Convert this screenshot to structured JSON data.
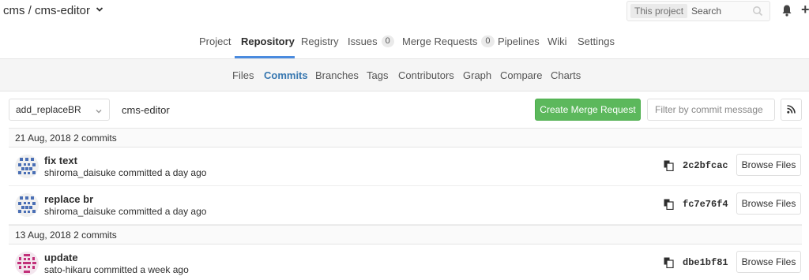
{
  "header": {
    "project_path": "cms / cms-editor",
    "search": {
      "scope": "This project",
      "placeholder": "Search"
    }
  },
  "project_nav": {
    "items": [
      {
        "label": "Project"
      },
      {
        "label": "Repository",
        "active": true
      },
      {
        "label": "Registry"
      },
      {
        "label": "Issues",
        "count": "0"
      },
      {
        "label": "Merge Requests",
        "count": "0"
      },
      {
        "label": "Pipelines"
      },
      {
        "label": "Wiki"
      },
      {
        "label": "Settings"
      }
    ]
  },
  "sub_nav": {
    "items": [
      {
        "label": "Files"
      },
      {
        "label": "Commits",
        "active": true
      },
      {
        "label": "Branches"
      },
      {
        "label": "Tags"
      },
      {
        "label": "Contributors"
      },
      {
        "label": "Graph"
      },
      {
        "label": "Compare"
      },
      {
        "label": "Charts"
      }
    ]
  },
  "toolbar": {
    "branch": "add_replaceBR",
    "path": "cms-editor",
    "create_mr_label": "Create Merge Request",
    "filter_placeholder": "Filter by commit message"
  },
  "commit_groups": [
    {
      "date": "21 Aug, 2018 2 commits",
      "commits": [
        {
          "title": "fix text",
          "author_line": "shiroma_daisuke committed a day ago",
          "sha": "2c2bfcac",
          "browse_label": "Browse Files",
          "avatar_color": "#4a6fb5"
        },
        {
          "title": "replace br",
          "author_line": "shiroma_daisuke committed a day ago",
          "sha": "fc7e76f4",
          "browse_label": "Browse Files",
          "avatar_color": "#4a6fb5"
        }
      ]
    },
    {
      "date": "13 Aug, 2018 2 commits",
      "commits": [
        {
          "title": "update",
          "author_line": "sato-hikaru committed a week ago",
          "sha": "dbe1bf81",
          "browse_label": "Browse Files",
          "avatar_color": "#c2307a"
        }
      ]
    }
  ],
  "colors": {
    "accent": "#4a8bdf",
    "active_link": "#3777b0",
    "success": "#5cb85c"
  }
}
